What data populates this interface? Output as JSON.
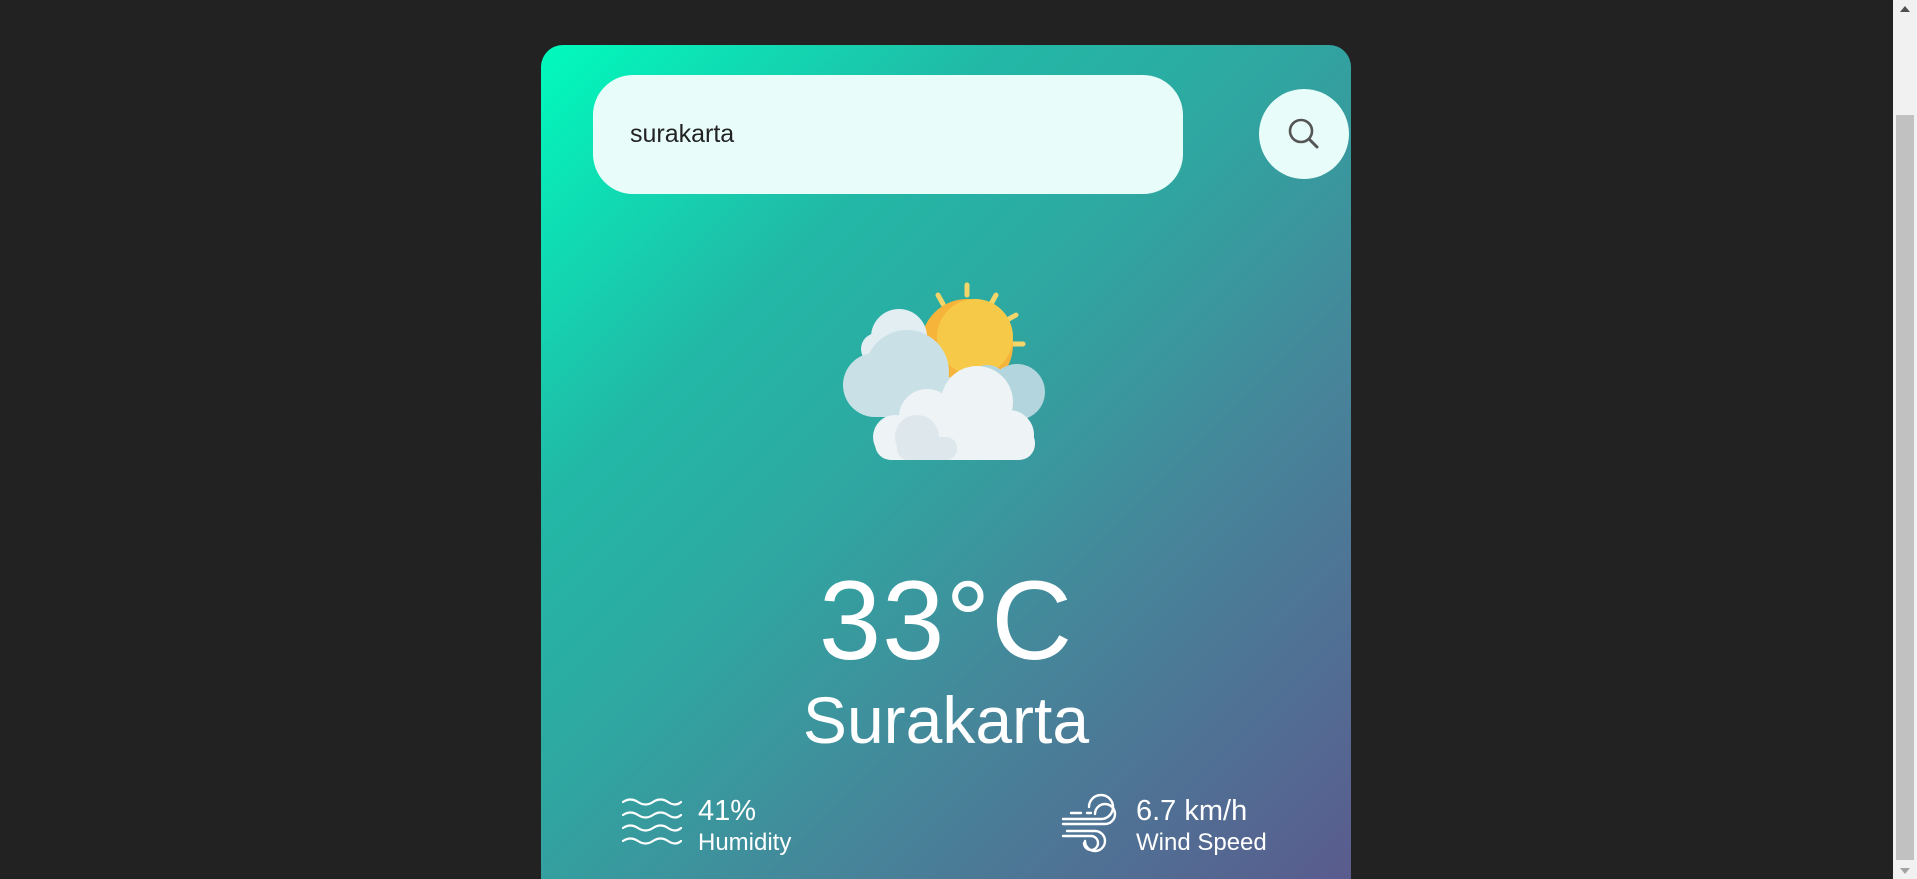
{
  "search": {
    "value": "surakarta",
    "button_icon": "search-icon"
  },
  "weather": {
    "icon": "sun-behind-clouds-icon",
    "temperature": "33°C",
    "city": "Surakarta"
  },
  "stats": {
    "humidity": {
      "icon": "humidity-waves-icon",
      "value": "41%",
      "label": "Humidity"
    },
    "wind": {
      "icon": "wind-icon",
      "value": "6.7 km/h",
      "label": "Wind Speed"
    }
  },
  "colors": {
    "page_background": "#222222",
    "card_gradient_start": "#00fbbe",
    "card_gradient_end": "#5a5b8e",
    "input_background": "#e8fdf9",
    "text": "#ffffff"
  }
}
